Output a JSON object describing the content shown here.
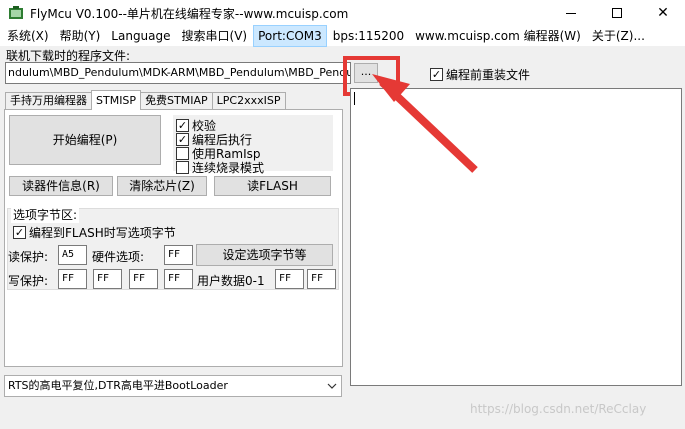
{
  "window": {
    "title": "FlyMcu V0.100--单片机在线编程专家--www.mcuisp.com",
    "controls": {
      "minimize": "minimize-icon",
      "maximize": "maximize-icon",
      "close": "✕"
    }
  },
  "menu": {
    "items": [
      {
        "label": "系统(X)"
      },
      {
        "label": "帮助(Y)"
      },
      {
        "label": "Language"
      },
      {
        "label": "搜索串口(V)"
      },
      {
        "label": "Port:COM3"
      },
      {
        "label": "bps:115200"
      },
      {
        "label": "www.mcuisp.com 编程器(W)"
      },
      {
        "label": "关于(Z)..."
      }
    ],
    "active_index": 4
  },
  "file": {
    "label": "联机下载时的程序文件:",
    "value": "ndulum\\MBD_Pendulum\\MDK-ARM\\MBD_Pendulum\\MBD_Pendulum.hex",
    "browse_label": "..."
  },
  "reload": {
    "label": "编程前重装文件",
    "checked": true
  },
  "tabs": [
    {
      "label": "手持万用编程器"
    },
    {
      "label": "STMISP"
    },
    {
      "label": "免费STMIAP"
    },
    {
      "label": "LPC2xxxISP"
    }
  ],
  "stmisp": {
    "program_button": "开始编程(P)",
    "options": [
      {
        "label": "校验",
        "checked": true
      },
      {
        "label": "编程后执行",
        "checked": true
      },
      {
        "label": "使用RamIsp",
        "checked": false
      },
      {
        "label": "连续烧录模式",
        "checked": false
      }
    ],
    "read_info_button": "读器件信息(R)",
    "erase_button": "清除芯片(Z)",
    "read_flash_button": "读FLASH",
    "option_group": {
      "title": "选项字节区:",
      "write_to_flash": {
        "label": "编程到FLASH时写选项字节",
        "checked": true
      },
      "read_protect_label": "读保护:",
      "read_protect_value": "A5",
      "hw_option_label": "硬件选项:",
      "hw_option_value": "FF",
      "set_option_button": "设定选项字节等",
      "write_protect_label": "写保护:",
      "write_protect_values": [
        "FF",
        "FF",
        "FF",
        "FF"
      ],
      "user_data_label": "用户数据0-1",
      "user_data_values": [
        "FF",
        "FF"
      ]
    }
  },
  "boot_select": {
    "value": "RTS的高电平复位,DTR高电平进BootLoader"
  },
  "watermark": "https://blog.csdn.net/ReCclay",
  "colors": {
    "annotation": "#e53935",
    "selected_menu": "#cce8ff"
  }
}
